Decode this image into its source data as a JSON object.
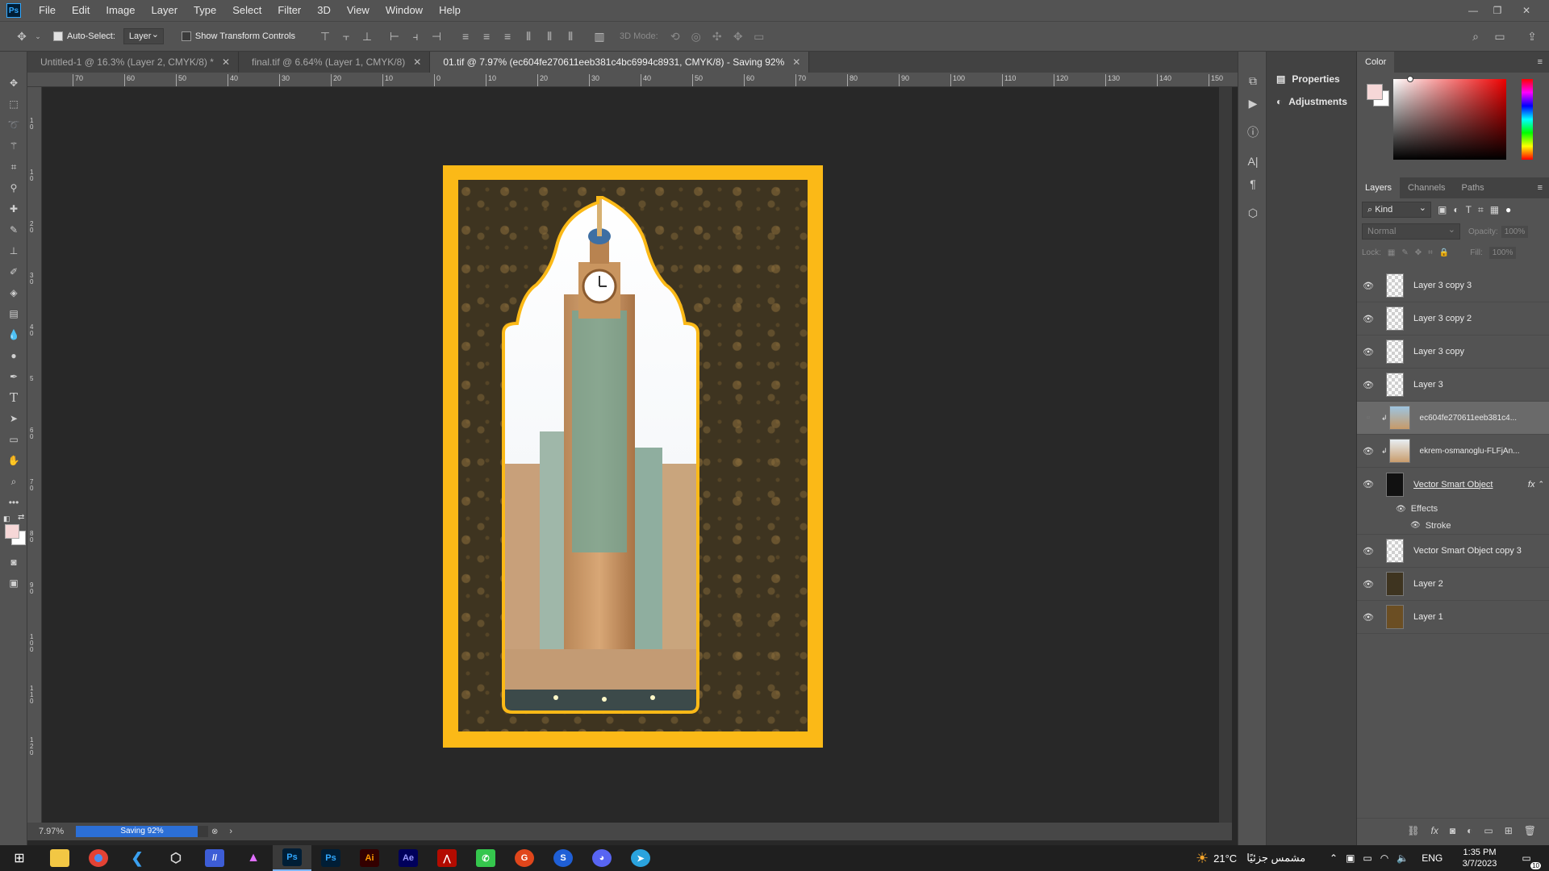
{
  "app": {
    "logo": "Ps",
    "menus": [
      "File",
      "Edit",
      "Image",
      "Layer",
      "Type",
      "Select",
      "Filter",
      "3D",
      "View",
      "Window",
      "Help"
    ]
  },
  "options": {
    "auto_select_label": "Auto-Select:",
    "auto_select_value": "Layer",
    "transform_label": "Show Transform Controls",
    "mode_3d": "3D Mode:"
  },
  "tabs": [
    {
      "label": "Untitled-1 @ 16.3% (Layer 2, CMYK/8) *"
    },
    {
      "label": "final.tif @ 6.64% (Layer 1, CMYK/8)"
    },
    {
      "label": "01.tif @ 7.97% (ec604fe270611eeb381c4bc6994c8931, CMYK/8) - Saving 92%"
    }
  ],
  "ruler": {
    "top": [
      "70",
      "60",
      "50",
      "40",
      "30",
      "20",
      "10",
      "0",
      "10",
      "20",
      "30",
      "40",
      "50",
      "60",
      "70",
      "80",
      "90",
      "100",
      "110",
      "120",
      "130",
      "140",
      "150"
    ],
    "left": [
      "1 0",
      "1 0",
      "2 0",
      "3 0",
      "4 0",
      "5",
      "6 0",
      "7 0",
      "8 0",
      "9 0",
      "1 0 0",
      "1 1 0",
      "1 2 0"
    ]
  },
  "status": {
    "zoom": "7.97%",
    "saving": "Saving 92%",
    "saving_progress": 0.92
  },
  "right_icons": [
    "history-icon",
    "play-icon",
    "info-icon",
    "character-icon",
    "paragraph-icon",
    "3d-icon"
  ],
  "properties_panel": {
    "properties_label": "Properties",
    "adjustments_label": "Adjustments"
  },
  "color_panel": {
    "title": "Color",
    "foreground": "#f6d7d7",
    "background": "#ffffff"
  },
  "layers_panel": {
    "tabs": [
      "Layers",
      "Channels",
      "Paths"
    ],
    "filter_label": "Kind",
    "blend_mode": "Normal",
    "opacity_label": "Opacity:",
    "opacity_value": "100%",
    "lock_label": "Lock:",
    "fill_label": "Fill:",
    "fill_value": "100%",
    "effects_label": "Effects",
    "stroke_label": "Stroke",
    "fx_label": "fx",
    "layers": [
      {
        "name": "Layer 3 copy 3"
      },
      {
        "name": "Layer 3 copy 2"
      },
      {
        "name": "Layer 3 copy"
      },
      {
        "name": "Layer 3"
      },
      {
        "name": "ec604fe270611eeb381c4..."
      },
      {
        "name": "ekrem-osmanoglu-FLFjAn..."
      },
      {
        "name": "Vector Smart Object"
      },
      {
        "name": "Vector Smart Object copy 3"
      },
      {
        "name": "Layer 2"
      },
      {
        "name": "Layer 1"
      }
    ]
  },
  "taskbar": {
    "weather": "21°C",
    "weather_text": "مشمس جزئيًا",
    "lang": "ENG",
    "time": "1:35 PM",
    "date": "3/7/2023",
    "notification_count": "10",
    "apps": [
      "Ps",
      "Ps",
      "Ai",
      "Ae"
    ]
  }
}
